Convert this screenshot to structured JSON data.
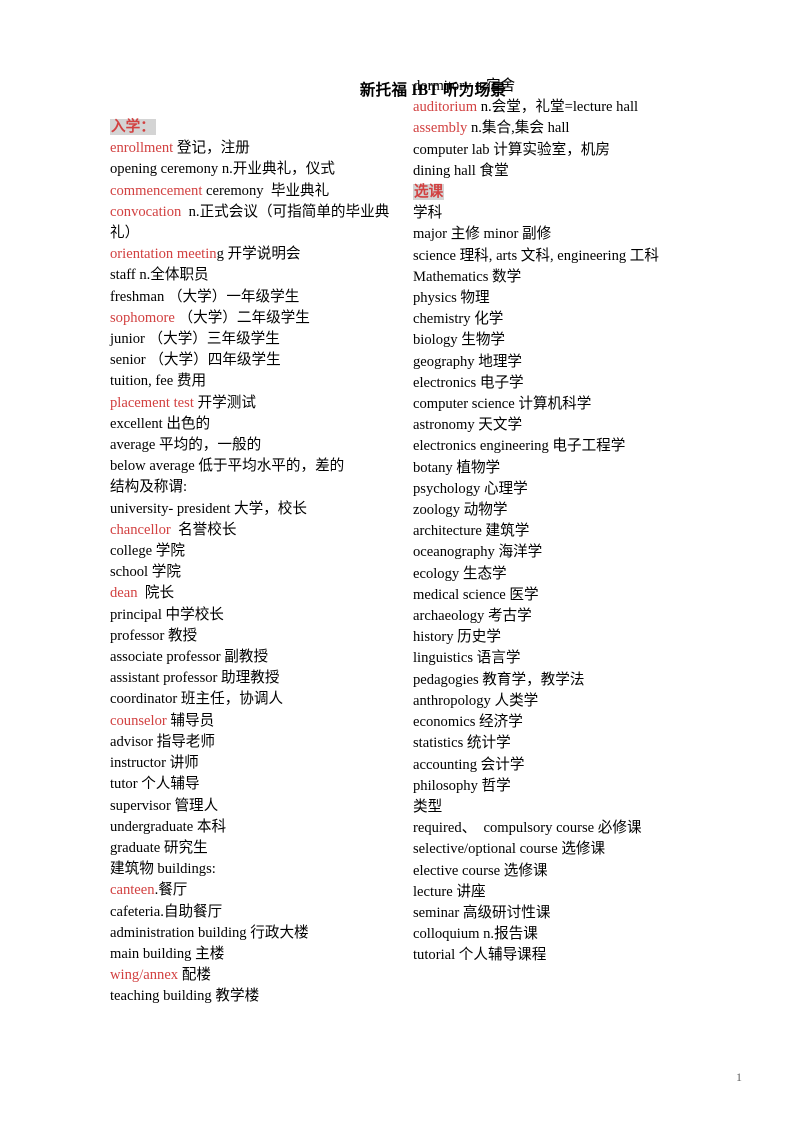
{
  "document": {
    "title": "新托福 IBT 听力场景",
    "page_number": "1",
    "accent_red": "#d24141",
    "highlight_gray": "#d4d4d4"
  },
  "left_column": {
    "section_header": "入学：",
    "entries": [
      {
        "red": "enrollment",
        "black": " 登记，注册"
      },
      {
        "red": "",
        "black": "opening ceremony n.开业典礼，仪式"
      },
      {
        "red": "commencement",
        "black": " ceremony  毕业典礼"
      },
      {
        "red": "convocation",
        "black": "  n.正式会议（可指简单的毕业典礼）"
      },
      {
        "red": "orientation meetin",
        "black": "g 开学说明会"
      },
      {
        "red": "",
        "black": "staff n.全体职员"
      },
      {
        "red": "",
        "black": "freshman （大学）一年级学生"
      },
      {
        "red": "sophomore",
        "black": " （大学）二年级学生"
      },
      {
        "red": "",
        "black": "junior （大学）三年级学生"
      },
      {
        "red": "",
        "black": "senior （大学）四年级学生"
      },
      {
        "red": "",
        "black": "tuition, fee 费用"
      },
      {
        "red": "placement test",
        "black": " 开学测试"
      },
      {
        "red": "",
        "black": "excellent 出色的"
      },
      {
        "red": "",
        "black": "average 平均的，一般的"
      },
      {
        "red": "",
        "black": "below average 低于平均水平的，差的"
      },
      {
        "red": "",
        "black": "结构及称谓:"
      },
      {
        "red": "",
        "black": "university- president 大学，校长"
      },
      {
        "red": "chancellor",
        "black": "  名誉校长"
      },
      {
        "red": "",
        "black": "college 学院"
      },
      {
        "red": "",
        "black": "school 学院"
      },
      {
        "red": "dean",
        "black": "  院长"
      },
      {
        "red": "",
        "black": "principal 中学校长"
      },
      {
        "red": "",
        "black": "professor 教授"
      },
      {
        "red": "",
        "black": "associate professor 副教授"
      },
      {
        "red": "",
        "black": "assistant professor 助理教授"
      },
      {
        "red": "",
        "black": "coordinator 班主任，协调人"
      },
      {
        "red": "counselor",
        "black": " 辅导员"
      },
      {
        "red": "",
        "black": "advisor 指导老师"
      },
      {
        "red": "",
        "black": "instructor 讲师"
      },
      {
        "red": "",
        "black": "tutor 个人辅导"
      },
      {
        "red": "",
        "black": "supervisor 管理人"
      },
      {
        "red": "",
        "black": "undergraduate 本科"
      },
      {
        "red": "",
        "black": "graduate 研究生"
      },
      {
        "red": "",
        "black": "建筑物 buildings:"
      },
      {
        "red": "canteen",
        "black": ".餐厅"
      },
      {
        "red": "",
        "black": "cafeteria.自助餐厅"
      },
      {
        "red": "",
        "black": "administration building 行政大楼"
      },
      {
        "red": "",
        "black": "main building 主楼"
      },
      {
        "red": "wing/annex",
        "black": " 配楼"
      },
      {
        "red": "",
        "black": "teaching building 教学楼"
      }
    ]
  },
  "right_column": {
    "entries_before_header": [
      {
        "red": "",
        "black": "dormitory n.宿舍"
      },
      {
        "red": "auditorium",
        "black": " n.会堂，礼堂=lecture hall"
      },
      {
        "red": "assembly",
        "black": " n.集合,集会 hall"
      },
      {
        "red": "",
        "black": "computer lab 计算实验室，机房"
      },
      {
        "red": "",
        "black": "dining hall 食堂"
      }
    ],
    "section_header": "选课",
    "entries_after_header": [
      {
        "red": "",
        "black": "学科"
      },
      {
        "red": "",
        "black": "major 主修 minor 副修"
      },
      {
        "red": "",
        "black": "science 理科, arts 文科, engineering 工科"
      },
      {
        "red": "",
        "black": "Mathematics 数学"
      },
      {
        "red": "",
        "black": "physics 物理"
      },
      {
        "red": "",
        "black": "chemistry 化学"
      },
      {
        "red": "",
        "black": "biology 生物学"
      },
      {
        "red": "",
        "black": "geography 地理学"
      },
      {
        "red": "",
        "black": "electronics 电子学"
      },
      {
        "red": "",
        "black": "computer science 计算机科学"
      },
      {
        "red": "",
        "black": "astronomy 天文学"
      },
      {
        "red": "",
        "black": "electronics engineering 电子工程学"
      },
      {
        "red": "",
        "black": "botany 植物学"
      },
      {
        "red": "",
        "black": "psychology 心理学"
      },
      {
        "red": "",
        "black": "zoology 动物学"
      },
      {
        "red": "",
        "black": "architecture 建筑学"
      },
      {
        "red": "",
        "black": "oceanography 海洋学"
      },
      {
        "red": "",
        "black": "ecology 生态学"
      },
      {
        "red": "",
        "black": "medical science 医学"
      },
      {
        "red": "",
        "black": "archaeology 考古学"
      },
      {
        "red": "",
        "black": "history 历史学"
      },
      {
        "red": "",
        "black": "linguistics 语言学"
      },
      {
        "red": "",
        "black": "pedagogies 教育学，教学法"
      },
      {
        "red": "",
        "black": "anthropology 人类学"
      },
      {
        "red": "",
        "black": "economics 经济学"
      },
      {
        "red": "",
        "black": "statistics 统计学"
      },
      {
        "red": "",
        "black": "accounting 会计学"
      },
      {
        "red": "",
        "black": "philosophy 哲学"
      },
      {
        "red": "",
        "black": "类型"
      },
      {
        "red": "",
        "black": "required、  compulsory course 必修课"
      },
      {
        "red": "",
        "black": "selective/optional course 选修课"
      },
      {
        "red": "",
        "black": "elective course 选修课"
      },
      {
        "red": "",
        "black": "lecture 讲座"
      },
      {
        "red": "",
        "black": "seminar 高级研讨性课"
      },
      {
        "red": "",
        "black": "colloquium n.报告课"
      },
      {
        "red": "",
        "black": "tutorial 个人辅导课程"
      }
    ]
  }
}
